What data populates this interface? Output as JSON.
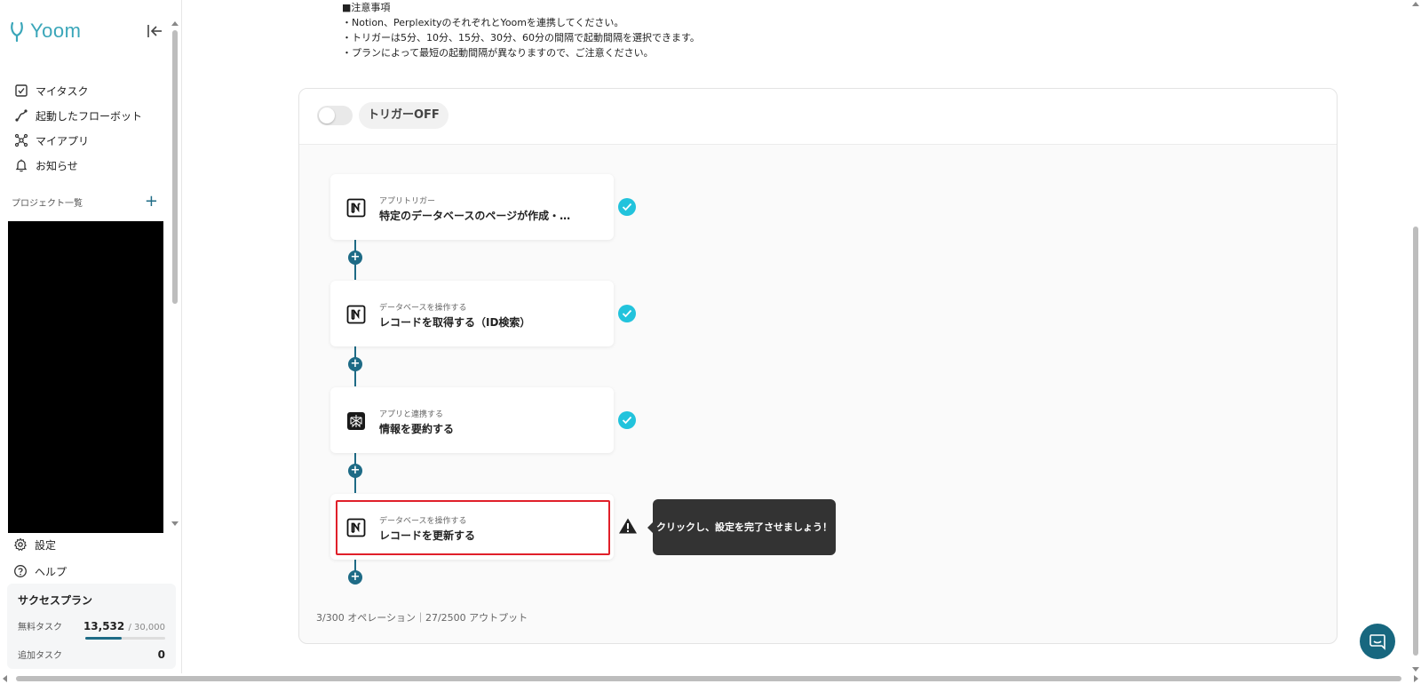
{
  "app": {
    "name": "Yoom",
    "brand_color": "#3aa6b9",
    "accent_color": "#1e6b86"
  },
  "sidebar": {
    "nav": [
      {
        "label": "マイタスク",
        "icon": "checkbox-icon"
      },
      {
        "label": "起動したフローボット",
        "icon": "flow-icon"
      },
      {
        "label": "マイアプリ",
        "icon": "apps-icon"
      },
      {
        "label": "お知らせ",
        "icon": "bell-icon"
      }
    ],
    "projects_title": "プロジェクト一覧",
    "projects_add": "+",
    "bottom": [
      {
        "label": "設定",
        "icon": "gear-icon"
      },
      {
        "label": "ヘルプ",
        "icon": "help-icon"
      }
    ],
    "plan": {
      "name": "サクセスプラン",
      "free_label": "無料タスク",
      "free_used": "13,532",
      "free_total": "/ 30,000",
      "free_fraction": 0.451,
      "extra_label": "追加タスク",
      "extra_value": "0"
    }
  },
  "notes": {
    "heading": "■注意事項",
    "lines": [
      "・Notion、PerplexityのそれぞれとYoomを連携してください。",
      "・トリガーは5分、10分、15分、30分、60分の間隔で起動間隔を選択できます。",
      "・プランによって最短の起動間隔が異なりますので、ご注意ください。"
    ]
  },
  "flow": {
    "trigger_state": "トリガーOFF",
    "steps": [
      {
        "sub": "アプリトリガー",
        "title": "特定のデータベースのページが作成・…",
        "app_icon": "notion-icon",
        "status": "complete"
      },
      {
        "sub": "データベースを操作する",
        "title": "レコードを取得する（ID検索）",
        "app_icon": "notion-icon",
        "status": "complete"
      },
      {
        "sub": "アプリと連携する",
        "title": "情報を要約する",
        "app_icon": "perplexity-icon",
        "status": "complete"
      },
      {
        "sub": "データベースを操作する",
        "title": "レコードを更新する",
        "app_icon": "notion-icon",
        "status": "incomplete"
      }
    ],
    "tooltip": "クリックし、設定を完了させましょう！",
    "operations": "3/300 オペレーション｜27/2500 アウトプット",
    "check_color": "#22c3dc",
    "highlight_color": "#e0202a"
  }
}
